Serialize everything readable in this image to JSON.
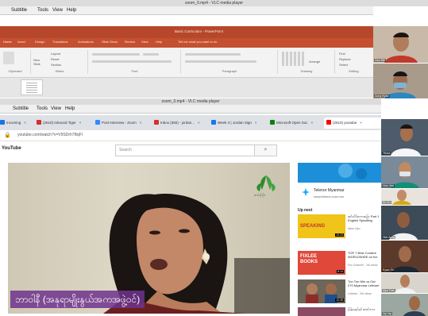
{
  "vlc_top": {
    "title": "zoom_0.mp4 - VLC media player",
    "menu": [
      "Subtitle",
      "Tools",
      "View",
      "Help"
    ]
  },
  "powerpoint": {
    "title": "Basic Curriculum - PowerPoint",
    "tabs": [
      "Home",
      "Insert",
      "Design",
      "Transitions",
      "Animations",
      "Slide Show",
      "Review",
      "View",
      "Help",
      "Tell me what you want to do"
    ],
    "groups": [
      "Clipboard",
      "Slides",
      "Font",
      "Paragraph",
      "Drawing",
      "Editing"
    ],
    "ribbon_buttons": [
      "Layout",
      "Reset",
      "Section",
      "New Slide",
      "Arrange",
      "Find",
      "Replace",
      "Select"
    ],
    "accent": "#c4502f"
  },
  "vlc_bottom": {
    "title": "zoom_0.mp4 - VLC media player",
    "menu": [
      "Subtitle",
      "Tools",
      "View",
      "Help"
    ]
  },
  "browser": {
    "tabs": [
      {
        "label": "Incoming",
        "color": "#1a73e8"
      },
      {
        "label": "(2610) Inbound Tiger",
        "color": "#d32f2f"
      },
      {
        "label": "Post Interview - Zoom",
        "color": "#2d8cff"
      },
      {
        "label": "Inbox (360) - jordan...",
        "color": "#d93025"
      },
      {
        "label": "Week 4 | Jordan Sign",
        "color": "#1877f2"
      },
      {
        "label": "Microsoft Open Soc",
        "color": "#107c10"
      },
      {
        "label": "(2610) youtube",
        "color": "#ff0000"
      }
    ],
    "url": "youtube.com/watch?v=V9SDrh7BqFI",
    "youtube_logo": "YouTube",
    "search_placeholder": "Search",
    "search_icon": "magnifier-icon"
  },
  "video": {
    "subtitle": "ဘာဝါနီ (အနုရာမျိုးနွယ်အကအဖွဲ့ဝင်)",
    "logo_text": "ထမ်းပိုးပိုး"
  },
  "sidebar": {
    "ad": {
      "title": "Telenor Myanmar",
      "sub": "www.telenor.com.mm"
    },
    "up_next": "Up next",
    "recommendations": [
      {
        "title": "အင်္ဂလိပ်စကားပြော Part 1 English Speaking",
        "meta": "Nann Nyo",
        "duration": "10:23",
        "thumb_color": "#f0c419",
        "thumb_label": "SPEAKING"
      },
      {
        "title": "TOP 7 Best Content WORLDWIDE on fox",
        "meta": "Fox Channel · 1M views",
        "duration": "8:14",
        "thumb_color": "#e0483a",
        "thumb_label": "FIXLEE BOOKS"
      },
      {
        "title": "Tun Tun Min vs Gai 070 Myanmar Lethwei",
        "meta": "Lethwei · 2M views",
        "duration": "12:45",
        "thumb_color": "#6d6659",
        "thumb_label": ""
      },
      {
        "title": "မြန်မာ့ရုပ်ရှင် ဇာတ်ကား",
        "meta": "",
        "duration": "",
        "thumb_color": "#8a4b63",
        "thumb_label": ""
      }
    ]
  },
  "participants": [
    {
      "name": "Zaw Min",
      "bg": "#c8b9a8",
      "shirt": "#c0392b",
      "skin": "#b07d5c"
    },
    {
      "name": "Aung Kyaw",
      "bg": "#a99b8c",
      "shirt": "#2e86c1",
      "skin": "#9c6b4e"
    },
    {
      "name": "Thura",
      "bg": "#4d5b6b",
      "shirt": "#f4f6f7",
      "skin": "#a5704d"
    },
    {
      "name": "Hnin Wai",
      "bg": "#7a8a99",
      "shirt": "#148f77",
      "skin": "#c08a64"
    },
    {
      "name": "Su Su",
      "bg": "#e8e3dc",
      "shirt": "#d4ac0d",
      "skin": "#c28c6a"
    },
    {
      "name": "Htet Aung",
      "bg": "#3d4a57",
      "shirt": "#f0f3f4",
      "skin": "#8e5d3f"
    },
    {
      "name": "Kyaw Zin",
      "bg": "#5b3a2b",
      "shirt": "#1c2833",
      "skin": "#a06b4c"
    },
    {
      "name": "Mya Thet",
      "bg": "#d9d4cc",
      "shirt": "#f2f3f4",
      "skin": "#b57f5c"
    },
    {
      "name": "Nyi Nyi",
      "bg": "#9aa8a1",
      "shirt": "#2c3e50",
      "skin": "#9d6a48"
    }
  ]
}
